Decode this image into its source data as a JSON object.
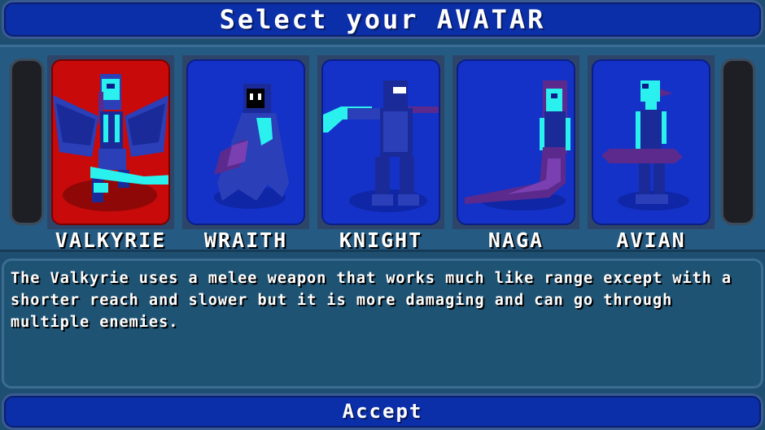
{
  "title": "Select your AVATAR",
  "avatars": [
    {
      "name": "VALKYRIE",
      "selected": true,
      "icon": "valkyrie-sprite"
    },
    {
      "name": "WRAITH",
      "selected": false,
      "icon": "wraith-sprite"
    },
    {
      "name": "KNIGHT",
      "selected": false,
      "icon": "knight-sprite"
    },
    {
      "name": "NAGA",
      "selected": false,
      "icon": "naga-sprite"
    },
    {
      "name": "AVIAN",
      "selected": false,
      "icon": "avian-sprite"
    }
  ],
  "description": "The Valkyrie uses a melee weapon that works much like range except with a shorter reach and slower but it is more damaging and can go through multiple enemies.",
  "accept_label": "Accept",
  "colors": {
    "panel_blue": "#0b2fa8",
    "card_blue": "#1432c8",
    "selected_red": "#c80a0a",
    "cyan": "#2af0ee",
    "purple": "#5b2a8c"
  }
}
